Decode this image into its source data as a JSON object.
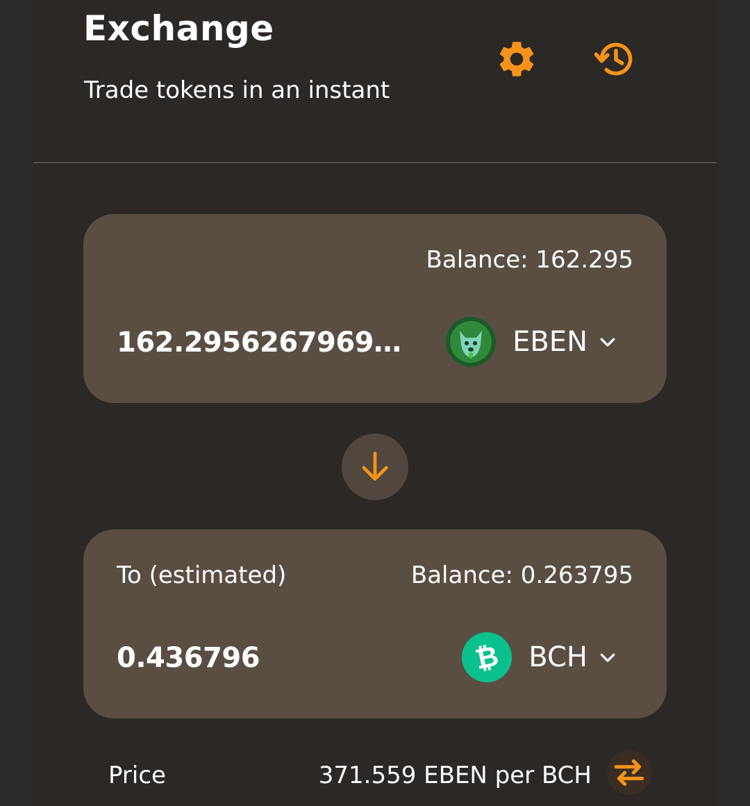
{
  "header": {
    "title": "Exchange",
    "subtitle": "Trade tokens in an instant",
    "settings_icon": "gear-icon",
    "history_icon": "history-icon"
  },
  "from": {
    "balance": "Balance: 162.295",
    "amount": "162.295626796941...",
    "token_symbol": "EBEN",
    "token_logo_icon": "eben-dog-logo"
  },
  "swap_direction_icon": "arrow-down-icon",
  "to": {
    "label": "To (estimated)",
    "balance": "Balance: 0.263795",
    "amount": "0.436796",
    "token_symbol": "BCH",
    "token_logo_icon": "bitcoin-cash-logo"
  },
  "price": {
    "label": "Price",
    "value": "371.559 EBEN per BCH",
    "invert_icon": "swap-arrows-icon"
  },
  "colors": {
    "accent": "#f7931a",
    "background": "#2b2a29",
    "panel": "#2c2826",
    "card": "#5a4e43",
    "bch_green": "#0ac18e"
  }
}
